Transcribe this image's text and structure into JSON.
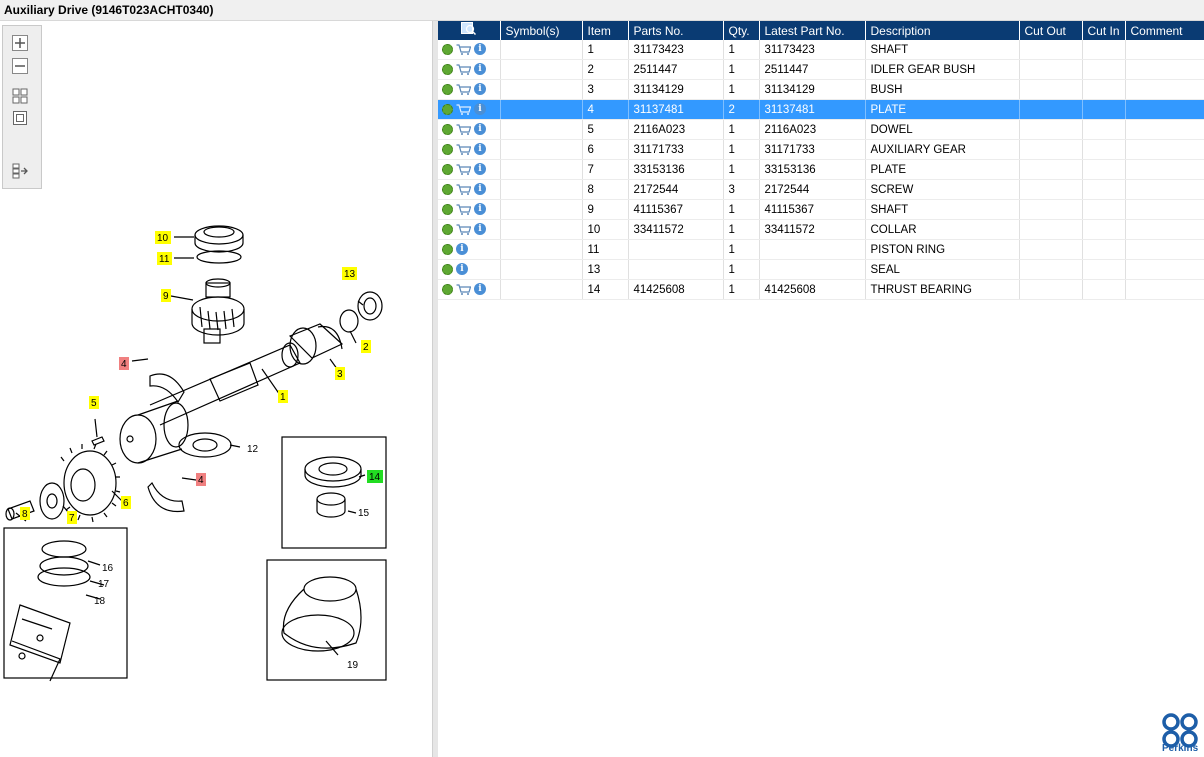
{
  "window": {
    "title": "Auxiliary Drive (9146T023ACHT0340)"
  },
  "toolbar": {
    "icons": [
      "zoom-in-icon",
      "zoom-out-icon",
      "fit-all-icon",
      "fit-page-icon",
      "export-icon"
    ]
  },
  "diagram": {
    "callouts": [
      "10",
      "11",
      "9",
      "13",
      "2",
      "3",
      "4",
      "1",
      "5",
      "12",
      "14",
      "6",
      "7",
      "8",
      "4",
      "15",
      "16",
      "17",
      "18",
      "19"
    ]
  },
  "grid": {
    "columns": [
      "Symbol(s)",
      "Item",
      "Parts No.",
      "Qty.",
      "Latest Part No.",
      "Description",
      "Cut Out",
      "Cut In",
      "Comment"
    ],
    "rows": [
      {
        "item": "1",
        "part": "31173423",
        "qty": "1",
        "latest": "31173423",
        "desc": "SHAFT",
        "cart": true,
        "sel": false
      },
      {
        "item": "2",
        "part": "2511447",
        "qty": "1",
        "latest": "2511447",
        "desc": "IDLER GEAR BUSH",
        "cart": true,
        "sel": false
      },
      {
        "item": "3",
        "part": "31134129",
        "qty": "1",
        "latest": "31134129",
        "desc": "BUSH",
        "cart": true,
        "sel": false
      },
      {
        "item": "4",
        "part": "31137481",
        "qty": "2",
        "latest": "31137481",
        "desc": "PLATE",
        "cart": true,
        "sel": true
      },
      {
        "item": "5",
        "part": "2116A023",
        "qty": "1",
        "latest": "2116A023",
        "desc": "DOWEL",
        "cart": true,
        "sel": false
      },
      {
        "item": "6",
        "part": "31171733",
        "qty": "1",
        "latest": "31171733",
        "desc": "AUXILIARY GEAR",
        "cart": true,
        "sel": false
      },
      {
        "item": "7",
        "part": "33153136",
        "qty": "1",
        "latest": "33153136",
        "desc": "PLATE",
        "cart": true,
        "sel": false
      },
      {
        "item": "8",
        "part": "2172544",
        "qty": "3",
        "latest": "2172544",
        "desc": "SCREW",
        "cart": true,
        "sel": false
      },
      {
        "item": "9",
        "part": "41115367",
        "qty": "1",
        "latest": "41115367",
        "desc": "SHAFT",
        "cart": true,
        "sel": false
      },
      {
        "item": "10",
        "part": "33411572",
        "qty": "1",
        "latest": "33411572",
        "desc": "COLLAR",
        "cart": true,
        "sel": false
      },
      {
        "item": "11",
        "part": "",
        "qty": "1",
        "latest": "",
        "desc": "PISTON RING",
        "cart": false,
        "sel": false
      },
      {
        "item": "13",
        "part": "",
        "qty": "1",
        "latest": "",
        "desc": "SEAL",
        "cart": false,
        "sel": false
      },
      {
        "item": "14",
        "part": "41425608",
        "qty": "1",
        "latest": "41425608",
        "desc": "THRUST BEARING",
        "cart": true,
        "sel": false
      }
    ]
  },
  "brand": {
    "name": "Perkins",
    "color": "#1d5ea8"
  },
  "colors": {
    "header": "#0a3b73",
    "selection": "#3399ff",
    "highlight_yellow": "#ffff00",
    "highlight_red": "#f08080",
    "highlight_green": "#22dd22"
  }
}
